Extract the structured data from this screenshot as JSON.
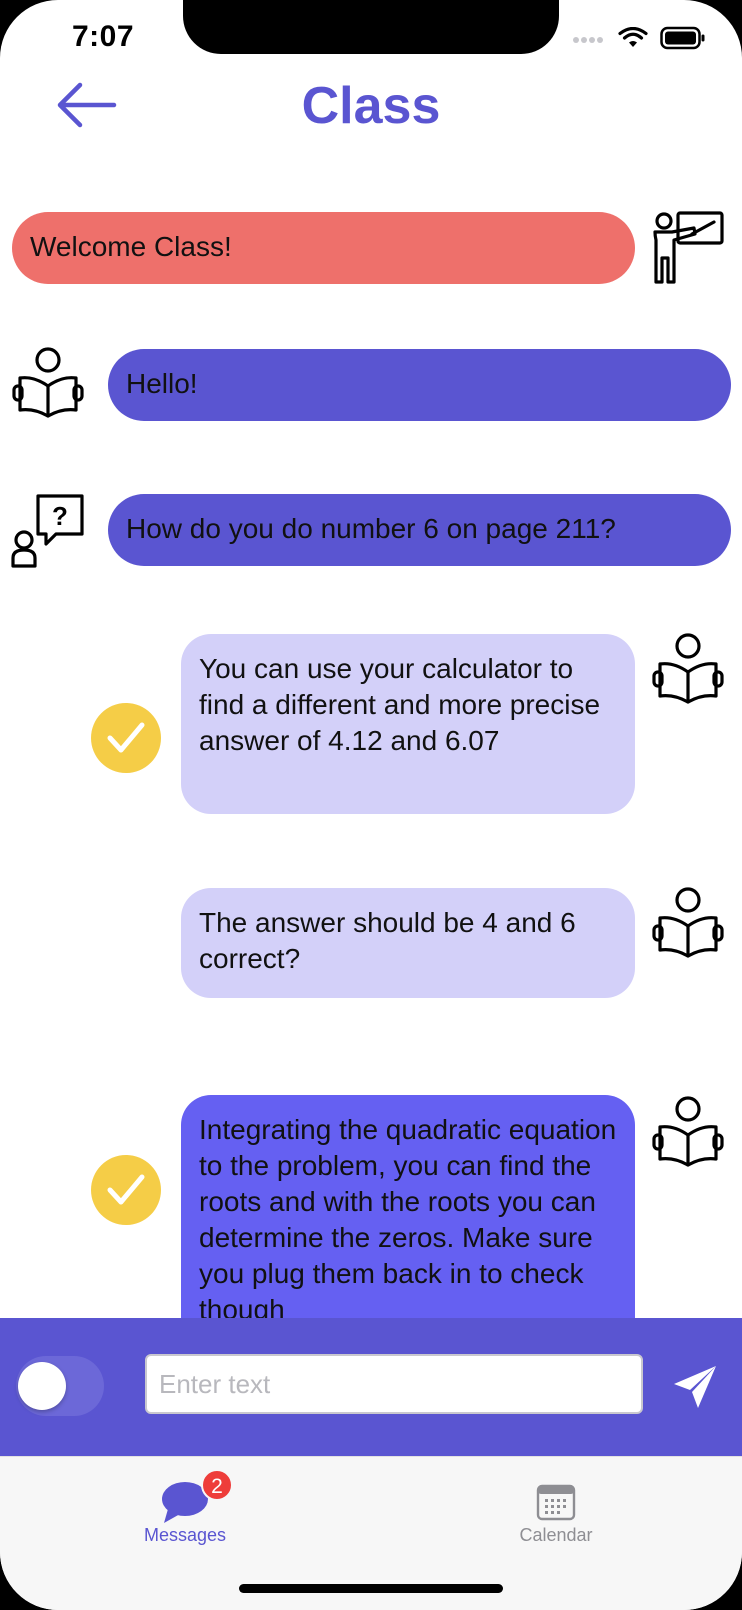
{
  "status_bar": {
    "time": "7:07"
  },
  "header": {
    "title": "Class"
  },
  "messages": [
    {
      "text": "Welcome Class!",
      "sender": "teacher",
      "style": "red",
      "checked": false
    },
    {
      "text": "Hello!",
      "sender": "student-reading",
      "style": "blue",
      "checked": false
    },
    {
      "text": "How do you do number 6 on page 211?",
      "sender": "student-question",
      "style": "blue",
      "checked": false
    },
    {
      "text": "You can use your calculator to find a different and more precise answer of 4.12 and 6.07",
      "sender": "student-reading",
      "style": "lavender",
      "checked": true
    },
    {
      "text": "The answer should be 4 and 6 correct?",
      "sender": "student-reading",
      "style": "lavender",
      "checked": false
    },
    {
      "text": "Integrating the quadratic equation to the problem, you can find the roots and with the roots you can determine the zeros. Make sure you plug them back in to check though",
      "sender": "student-reading",
      "style": "violet",
      "checked": true
    }
  ],
  "composer": {
    "placeholder": "Enter text",
    "value": ""
  },
  "tabs": [
    {
      "label": "Messages",
      "badge": "2",
      "active": true
    },
    {
      "label": "Calendar",
      "badge": "",
      "active": false
    }
  ],
  "colors": {
    "accent": "#5a55d1",
    "teacher_bubble": "#ee706b",
    "lavender_bubble": "#d3d0f9",
    "violet_bubble": "#6560f2",
    "check": "#f5cd47",
    "badge": "#ee3d3a",
    "inactive_tab": "#8e8e93"
  }
}
